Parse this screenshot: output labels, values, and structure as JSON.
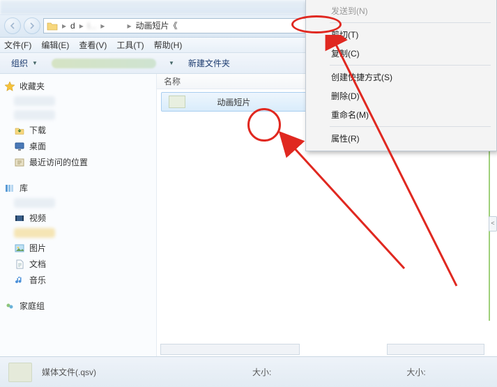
{
  "addressbar": {
    "crumb1": "d",
    "crumb2": "l...",
    "crumb3": "动画短片《"
  },
  "menubar": {
    "file": "文件(F)",
    "edit": "编辑(E)",
    "view": "查看(V)",
    "tools": "工具(T)",
    "help": "帮助(H)"
  },
  "toolbar": {
    "organize": "组织",
    "newfolder": "新建文件夹"
  },
  "navpane": {
    "favorites": "收藏夹",
    "downloads": "下载",
    "desktop": "桌面",
    "recent": "最近访问的位置",
    "libraries": "库",
    "videos": "视频",
    "pictures": "图片",
    "documents": "文档",
    "music": "音乐",
    "homegroup": "家庭组"
  },
  "content": {
    "col_name": "名称",
    "file1": "动画短片"
  },
  "context_menu": {
    "sendTo": "发送到(N)",
    "cut": "剪切(T)",
    "copy": "复制(C)",
    "shortcut": "创建快捷方式(S)",
    "delete": "删除(D)",
    "rename": "重命名(M)",
    "properties": "属性(R)"
  },
  "statusbar": {
    "filetype": "媒体文件(.qsv)",
    "size_label": "大小:",
    "size_label2": "大小:"
  },
  "preview_caret": "<"
}
